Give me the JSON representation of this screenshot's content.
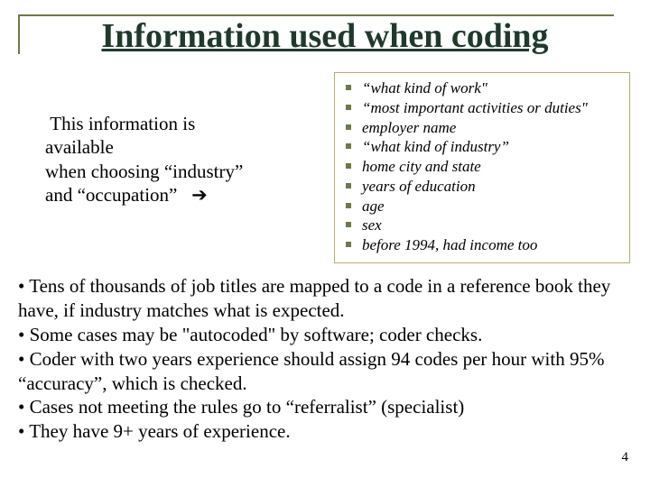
{
  "title": "Information used when coding",
  "left": {
    "l1": "This information is",
    "l2": "available",
    "l3": "when choosing “industry”",
    "l4": "and “occupation”",
    "arrow": "➔"
  },
  "list": {
    "i0": "“what kind of work\"",
    "i1": "“most important activities or duties\"",
    "i2": "employer name",
    "i3": "“what kind of industry”",
    "i4": "home city and state",
    "i5": "years of education",
    "i6": "age",
    "i7": "sex",
    "i8": "before 1994, had income too"
  },
  "body": {
    "p1": "• Tens of thousands of job titles are mapped to a code in a reference book they have, if industry matches what is expected.",
    "p2": "• Some cases may be \"autocoded\" by software; coder checks.",
    "p3": "• Coder with two years experience should assign 94 codes per hour with 95% “accuracy”, which is checked.",
    "p4": "• Cases not meeting the rules go to “referralist” (specialist)",
    "p5": "• They have 9+ years of experience."
  },
  "page": "4"
}
